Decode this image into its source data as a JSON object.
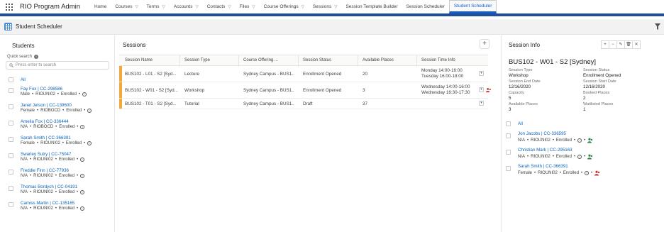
{
  "app": {
    "name": "RIO Program Admin"
  },
  "nav": [
    {
      "label": "Home",
      "chevron": false,
      "active": false
    },
    {
      "label": "Courses",
      "chevron": true,
      "active": false
    },
    {
      "label": "Terms",
      "chevron": true,
      "active": false
    },
    {
      "label": "Accounts",
      "chevron": true,
      "active": false
    },
    {
      "label": "Contacts",
      "chevron": true,
      "active": false
    },
    {
      "label": "Files",
      "chevron": true,
      "active": false
    },
    {
      "label": "Course Offerings",
      "chevron": true,
      "active": false
    },
    {
      "label": "Sessions",
      "chevron": true,
      "active": false
    },
    {
      "label": "Session Template Builder",
      "chevron": false,
      "active": false
    },
    {
      "label": "Session Scheduler",
      "chevron": false,
      "active": false
    },
    {
      "label": "Student Scheduler",
      "chevron": false,
      "active": true
    }
  ],
  "page": {
    "title": "Student Scheduler"
  },
  "students": {
    "title": "Students",
    "quick_search_label": "Quick search",
    "search_placeholder": "Press enter to search",
    "all_label": "All",
    "items": [
      {
        "name": "Fay Fox | CC-298586",
        "gender": "Male",
        "program": "RIOUNI02",
        "status": "Enrolled"
      },
      {
        "name": "Janet Jetson | CC-139600",
        "gender": "Female",
        "program": "RIOBOCD",
        "status": "Enrolled"
      },
      {
        "name": "Amelia Fox | CC-336444",
        "gender": "N/A",
        "program": "RIOBOCD",
        "status": "Enrolled"
      },
      {
        "name": "Sarah Smith | CC-366391",
        "gender": "Female",
        "program": "RIOUNI02",
        "status": "Enrolled"
      },
      {
        "name": "Swarley Sutry | CC-75047",
        "gender": "N/A",
        "program": "RIOUNI02",
        "status": "Enrolled"
      },
      {
        "name": "Freddie Finn | CC-77936",
        "gender": "N/A",
        "program": "RIOUNI02",
        "status": "Enrolled"
      },
      {
        "name": "Thomas Bordych | CC-04191",
        "gender": "N/A",
        "program": "RIOUNI02",
        "status": "Enrolled"
      },
      {
        "name": "Camiss Martin | CC-135165",
        "gender": "N/A",
        "program": "RIOUNI02",
        "status": "Enrolled"
      }
    ]
  },
  "sessions": {
    "title": "Sessions",
    "add_label": "+",
    "columns": [
      "Session Name",
      "Session Type",
      "Course Offering ...",
      "Session Status",
      "Available Places",
      "Session Time Info"
    ],
    "rows": [
      {
        "name": "BUS102 - L01 - S2 [Syd...",
        "type": "Lecture",
        "offering": "Sydney Campus - BUS1...",
        "status": "Enrollment Opened",
        "places": "20",
        "time1": "Monday 14:00-16:00",
        "time2": "Tuesday 16:00-18:00",
        "alert": false
      },
      {
        "name": "BUS102 - W01 - S2 [Syd...",
        "type": "Workshop",
        "offering": "Sydney Campus - BUS1...",
        "status": "Enrollment Opened",
        "places": "3",
        "time1": "Wednesday 14:00-16:00",
        "time2": "Wednesday 16:30-17:30",
        "alert": true
      },
      {
        "name": "BUS102 - T01 - S2 [Syd...",
        "type": "Tutorial",
        "offering": "Sydney Campus - BUS1...",
        "status": "Draft",
        "places": "37",
        "time1": "",
        "time2": "",
        "alert": false
      }
    ]
  },
  "session_info": {
    "title": "Session Info",
    "session_title": "BUS102 - W01 - S2 [Sydney]",
    "fields": {
      "type_label": "Session Type",
      "type_value": "Workshop",
      "status_label": "Session Status",
      "status_value": "Enrollment Opened",
      "end_label": "Session End Date",
      "end_value": "12/16/2020",
      "start_label": "Session Start Date",
      "start_value": "12/16/2020",
      "capacity_label": "Capacity",
      "capacity_value": "5",
      "booked_label": "Booked Places",
      "booked_value": "2",
      "available_label": "Available Places",
      "available_value": "3",
      "waitlisted_label": "Waitlisted Places",
      "waitlisted_value": "1"
    },
    "all_label": "All",
    "enrolled": [
      {
        "name": "Jon Jacobs | CC-336595",
        "gender": "N/A",
        "program": "RIOUNI02",
        "status": "Enrolled",
        "icon_color": "#2e844a"
      },
      {
        "name": "Christian Mark | CC-295163",
        "gender": "N/A",
        "program": "RIOUNI02",
        "status": "Enrolled",
        "icon_color": "#2e844a"
      },
      {
        "name": "Sarah Smith | CC-366391",
        "gender": "Female",
        "program": "RIOUNI02",
        "status": "Enrolled",
        "icon_color": "#c23934"
      }
    ]
  },
  "colors": {
    "accent": "#1b5dbf",
    "nav_bar": "#1f4e9c",
    "session_bar": "#f4a83a",
    "link": "#0a63b8",
    "alert": "#c23934"
  }
}
